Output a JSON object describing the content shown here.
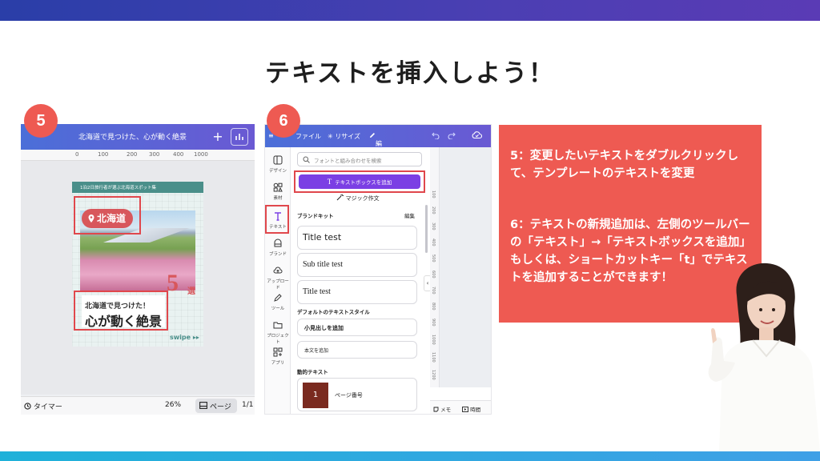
{
  "slide": {
    "title": "テキストを挿入しよう！"
  },
  "colors": {
    "accent_red": "#ee5a52",
    "header_gradient_start": "#4b6fd8",
    "header_gradient_end": "#6a59d3",
    "button_purple": "#7b3fe4"
  },
  "step5": {
    "badge": "5",
    "topbar": {
      "title": "北海道で見つけた、心が動く絶景",
      "plus_icon": "plus-icon",
      "chart_icon": "bar-chart-icon"
    },
    "ruler_ticks": [
      "0",
      "100",
      "200",
      "300",
      "400",
      "500",
      "600",
      "700",
      "800",
      "900",
      "1000"
    ],
    "flyer": {
      "banner": "1泊2日旅行者が選ぶ北海道スポット集",
      "location": "北海道",
      "number": "5",
      "number_suffix": "選",
      "caption_small": "北海道で見つけた！",
      "caption_big": "心が動く絶景",
      "swipe": "swipe ▸▸"
    },
    "thumbnail_label": "1",
    "add_page_plus": "+",
    "add_page_chevron": "⌄",
    "bottom": {
      "timer": "タイマー",
      "zoom": "26%",
      "page_button": "ページ",
      "page_count": "1/1"
    }
  },
  "step6": {
    "badge": "6",
    "topbar": {
      "menu_icon": "≡",
      "file": "ファイル",
      "resize": "✳ リサイズ",
      "edit_mode": "編集モード",
      "edit_mode_chevron": "⌄"
    },
    "rail": [
      {
        "label": "デザイン",
        "icon": "design-icon"
      },
      {
        "label": "素材",
        "icon": "elements-icon"
      },
      {
        "label": "テキスト",
        "icon": "text-icon"
      },
      {
        "label": "ブランド",
        "icon": "brand-icon"
      },
      {
        "label": "アップロード",
        "icon": "upload-icon"
      },
      {
        "label": "ツール",
        "icon": "draw-icon"
      },
      {
        "label": "プロジェクト",
        "icon": "folder-icon"
      },
      {
        "label": "アプリ",
        "icon": "apps-icon"
      }
    ],
    "search_placeholder": "フォントと組み合わせを検索",
    "add_textbox_button": "テキストボックスを追加",
    "magic_write": "マジック作文",
    "brand_kit": "ブランドキット",
    "brand_kit_edit": "編集",
    "brand_styles": [
      "Title test",
      "Sub title test",
      "Title test"
    ],
    "default_styles_heading": "デフォルトのテキストスタイル",
    "default_styles": [
      "小見出しを追加",
      "本文を追加"
    ],
    "dynamic_heading": "動的テキスト",
    "dynamic_item": {
      "label": "ページ番号",
      "thumb_text": "1"
    },
    "ruler_ticks": [
      "100",
      "200",
      "300",
      "400",
      "500",
      "600",
      "700",
      "800",
      "900",
      "1000",
      "1100",
      "1200"
    ],
    "collapse_chevron": "‹",
    "bottom": {
      "notes": "メモ",
      "time": "時間"
    }
  },
  "info": {
    "line5": "5：変更したいテキストをダブルクリックして、テンプレートのテキストを変更",
    "line6": "6：テキストの新規追加は、左側のツールバーの「テキスト」→「テキストボックスを追加」もしくは、ショートカットキー「t」でテキストを追加することができます！"
  }
}
